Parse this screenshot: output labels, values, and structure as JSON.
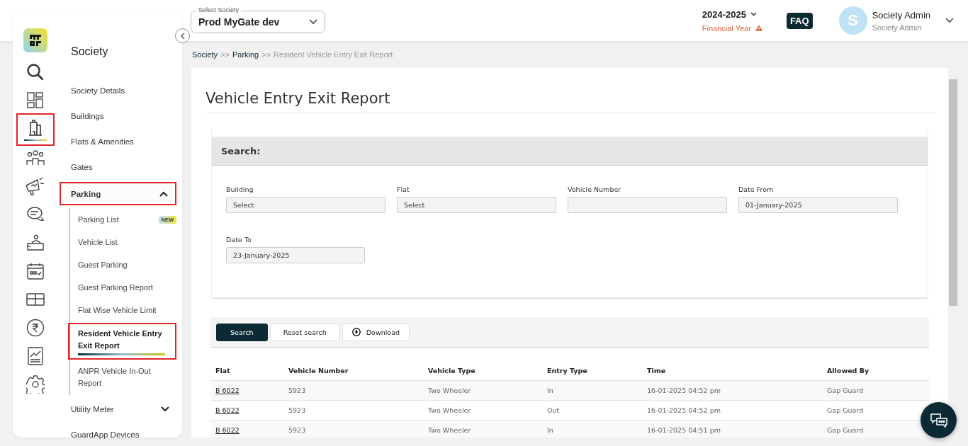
{
  "society_select": {
    "label": "Select Society",
    "value": "Prod MyGate dev"
  },
  "financial_year": {
    "value": "2024-2025",
    "label": "Financial Year"
  },
  "faq_button": "FAQ",
  "user": {
    "initial": "S",
    "name": "Society Admin",
    "role": "Society Admin"
  },
  "rail_icons": [
    {
      "kind": "logo",
      "selected": false
    },
    {
      "kind": "search",
      "selected": false
    },
    {
      "kind": "dashboard",
      "selected": false
    },
    {
      "kind": "building",
      "selected": true
    },
    {
      "kind": "people",
      "selected": false
    },
    {
      "kind": "megaphone",
      "selected": false
    },
    {
      "kind": "chat",
      "selected": false
    },
    {
      "kind": "reception",
      "selected": false
    },
    {
      "kind": "calendar",
      "selected": false
    },
    {
      "kind": "boxes",
      "selected": false
    },
    {
      "kind": "rupee",
      "selected": false
    },
    {
      "kind": "report",
      "selected": false
    },
    {
      "kind": "settings",
      "selected": false
    }
  ],
  "sidebar": {
    "title": "Society",
    "items": [
      {
        "label": "Society Details",
        "kind": "link"
      },
      {
        "label": "Buildings",
        "kind": "link"
      },
      {
        "label": "Flats & Amenities",
        "kind": "link"
      },
      {
        "label": "Gates",
        "kind": "link"
      },
      {
        "label": "Parking",
        "kind": "group",
        "expanded": true,
        "children": [
          {
            "label": "Parking List",
            "badge": "NEW",
            "selected": false
          },
          {
            "label": "Vehicle List",
            "selected": false
          },
          {
            "label": "Guest Parking",
            "selected": false
          },
          {
            "label": "Guest Parking Report",
            "selected": false
          },
          {
            "label": "Flat Wise Vehicle Limit",
            "selected": false
          },
          {
            "label": "Resident Vehicle Entry Exit Report",
            "selected": true
          },
          {
            "label": "ANPR Vehicle In-Out Report",
            "selected": false
          }
        ]
      },
      {
        "label": "Utility Meter",
        "kind": "group",
        "expanded": false
      },
      {
        "label": "GuardApp Devices",
        "kind": "link"
      }
    ]
  },
  "breadcrumb": [
    {
      "label": "Society",
      "kind": "link"
    },
    {
      "separator": ">>",
      "label": "Parking",
      "kind": "link"
    },
    {
      "separator": ">>",
      "label": "Resident Vehicle Entry Exit Report",
      "kind": "current"
    }
  ],
  "page_title": "Vehicle Entry Exit Report",
  "search_panel": {
    "heading": "Search:",
    "fields": [
      {
        "label": "Building",
        "value": "Select"
      },
      {
        "label": "Flat",
        "value": "Select"
      },
      {
        "label": "Vehicle Number"
      },
      {
        "label": "Date From",
        "value": "01-January-2025"
      },
      {
        "label": "Date To",
        "value": "23-January-2025"
      }
    ]
  },
  "buttons": [
    {
      "label": "Search",
      "kind": "primary"
    },
    {
      "label": "Reset search",
      "kind": "secondary"
    },
    {
      "label": "Download",
      "kind": "download"
    }
  ],
  "table": {
    "columns": [
      "Flat",
      "Vehicle Number",
      "Vehicle Type",
      "Entry Type",
      "Time",
      "Allowed By"
    ],
    "rows": [
      [
        "B 6022",
        "5923",
        "Two Wheeler",
        "In",
        "16-01-2025 04:52 pm",
        "Gap Guard"
      ],
      [
        "B 6022",
        "5923",
        "Two Wheeler",
        "Out",
        "16-01-2025 04:52 pm",
        "Gap Guard"
      ],
      [
        "B 6022",
        "5923",
        "Two Wheeler",
        "In",
        "16-01-2025 04:51 pm",
        "Gap Guard"
      ]
    ]
  }
}
